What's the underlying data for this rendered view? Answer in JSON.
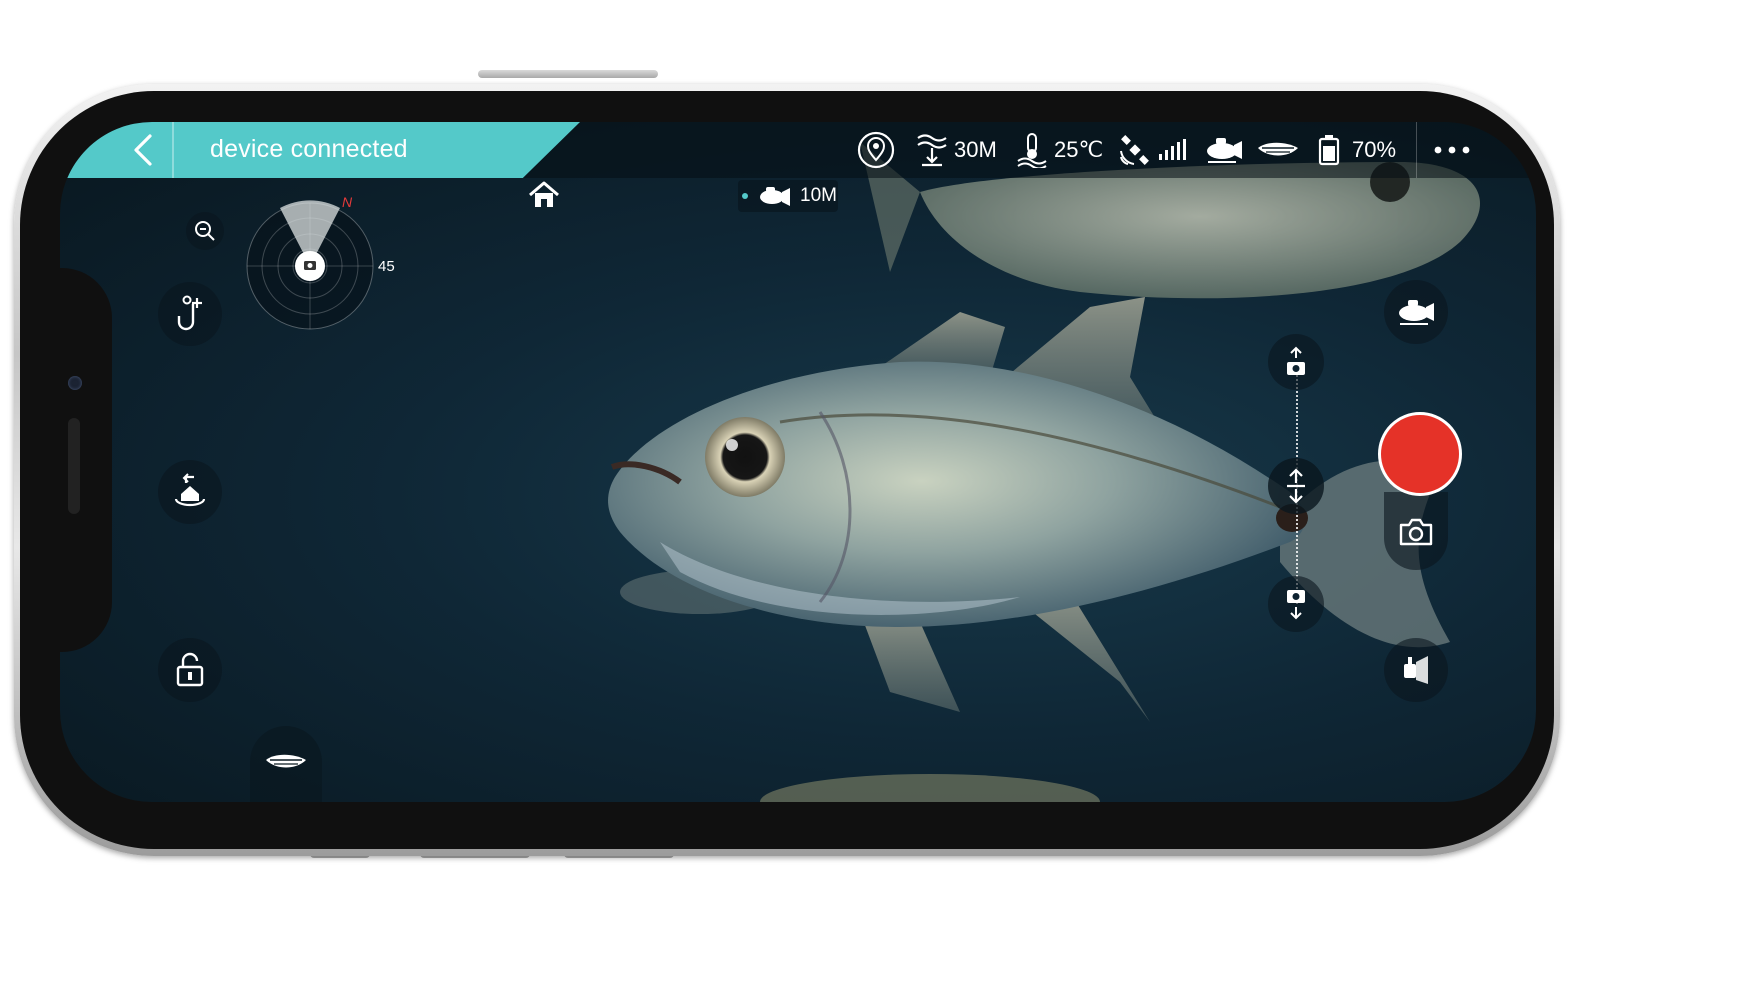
{
  "status_bar": {
    "connection_text": "device connected",
    "depth_limit": "30M",
    "water_temp": "25℃",
    "battery": "70%"
  },
  "overlay": {
    "fish_depth": "10M",
    "compass_north": "N",
    "radar_angle": "45"
  },
  "controls": {
    "record_color": "#e53228",
    "accent_color": "#54c9c9"
  },
  "icons": {
    "back": "chevron-left-icon",
    "location": "location-pin-icon",
    "depth": "wave-depth-icon",
    "temperature": "thermometer-icon",
    "satellite": "satellite-icon",
    "signal": "signal-bars-icon",
    "drone": "drone-icon",
    "boat": "boat-icon",
    "battery": "battery-icon",
    "more": "more-dots-icon",
    "home": "home-icon",
    "zoom_out": "zoom-out-icon",
    "hook": "hook-add-icon",
    "return_home": "return-home-icon",
    "lock": "unlock-icon",
    "camera": "camera-icon"
  }
}
